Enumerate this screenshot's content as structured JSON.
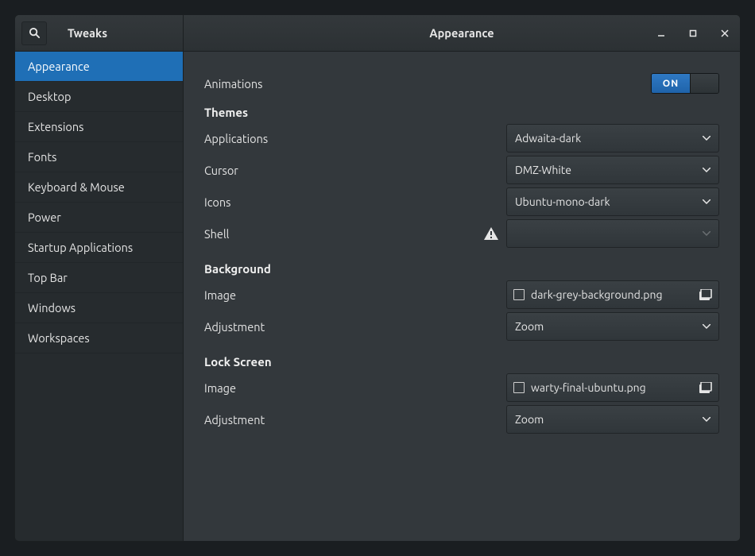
{
  "app_title": "Tweaks",
  "page_title": "Appearance",
  "sidebar": {
    "items": [
      {
        "label": "Appearance",
        "selected": true
      },
      {
        "label": "Desktop"
      },
      {
        "label": "Extensions"
      },
      {
        "label": "Fonts"
      },
      {
        "label": "Keyboard & Mouse"
      },
      {
        "label": "Power"
      },
      {
        "label": "Startup Applications"
      },
      {
        "label": "Top Bar"
      },
      {
        "label": "Windows"
      },
      {
        "label": "Workspaces"
      }
    ]
  },
  "content": {
    "animations": {
      "label": "Animations",
      "switch_text": "ON",
      "value": true
    },
    "themes": {
      "heading": "Themes",
      "applications": {
        "label": "Applications",
        "value": "Adwaita-dark"
      },
      "cursor": {
        "label": "Cursor",
        "value": "DMZ-White"
      },
      "icons": {
        "label": "Icons",
        "value": "Ubuntu-mono-dark"
      },
      "shell": {
        "label": "Shell",
        "value": "",
        "disabled": true,
        "warning": true
      }
    },
    "background": {
      "heading": "Background",
      "image": {
        "label": "Image",
        "value": "dark-grey-background.png"
      },
      "adjustment": {
        "label": "Adjustment",
        "value": "Zoom"
      }
    },
    "lockscreen": {
      "heading": "Lock Screen",
      "image": {
        "label": "Image",
        "value": "warty-final-ubuntu.png"
      },
      "adjustment": {
        "label": "Adjustment",
        "value": "Zoom"
      }
    }
  }
}
